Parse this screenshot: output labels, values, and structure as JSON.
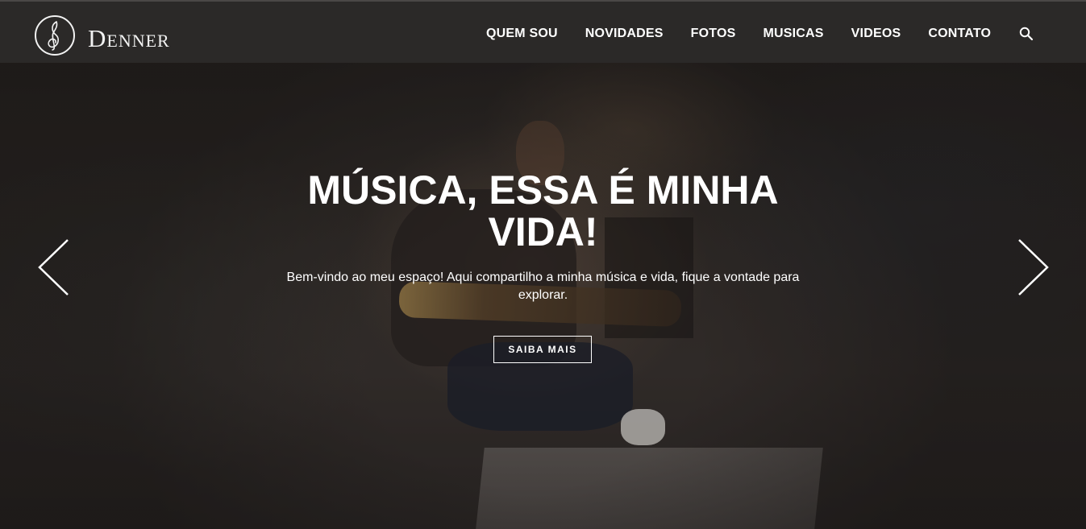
{
  "brand": {
    "name": "Denner",
    "logo_icon": "treble-clef-icon"
  },
  "nav": {
    "items": [
      {
        "label": "QUEM SOU"
      },
      {
        "label": "NOVIDADES"
      },
      {
        "label": "FOTOS"
      },
      {
        "label": "MUSICAS"
      },
      {
        "label": "VIDEOS"
      },
      {
        "label": "CONTATO"
      }
    ],
    "search_icon": "search-icon"
  },
  "hero": {
    "headline": "MÚSICA, ESSA É MINHA VIDA!",
    "subtext": "Bem-vindo ao meu espaço! Aqui compartilho a minha música e vida, fique a vontade para explorar.",
    "cta_label": "SAIBA MAIS",
    "prev_icon": "chevron-left-icon",
    "next_icon": "chevron-right-icon"
  },
  "colors": {
    "header_bg": "#2b2928",
    "text": "#ffffff"
  }
}
